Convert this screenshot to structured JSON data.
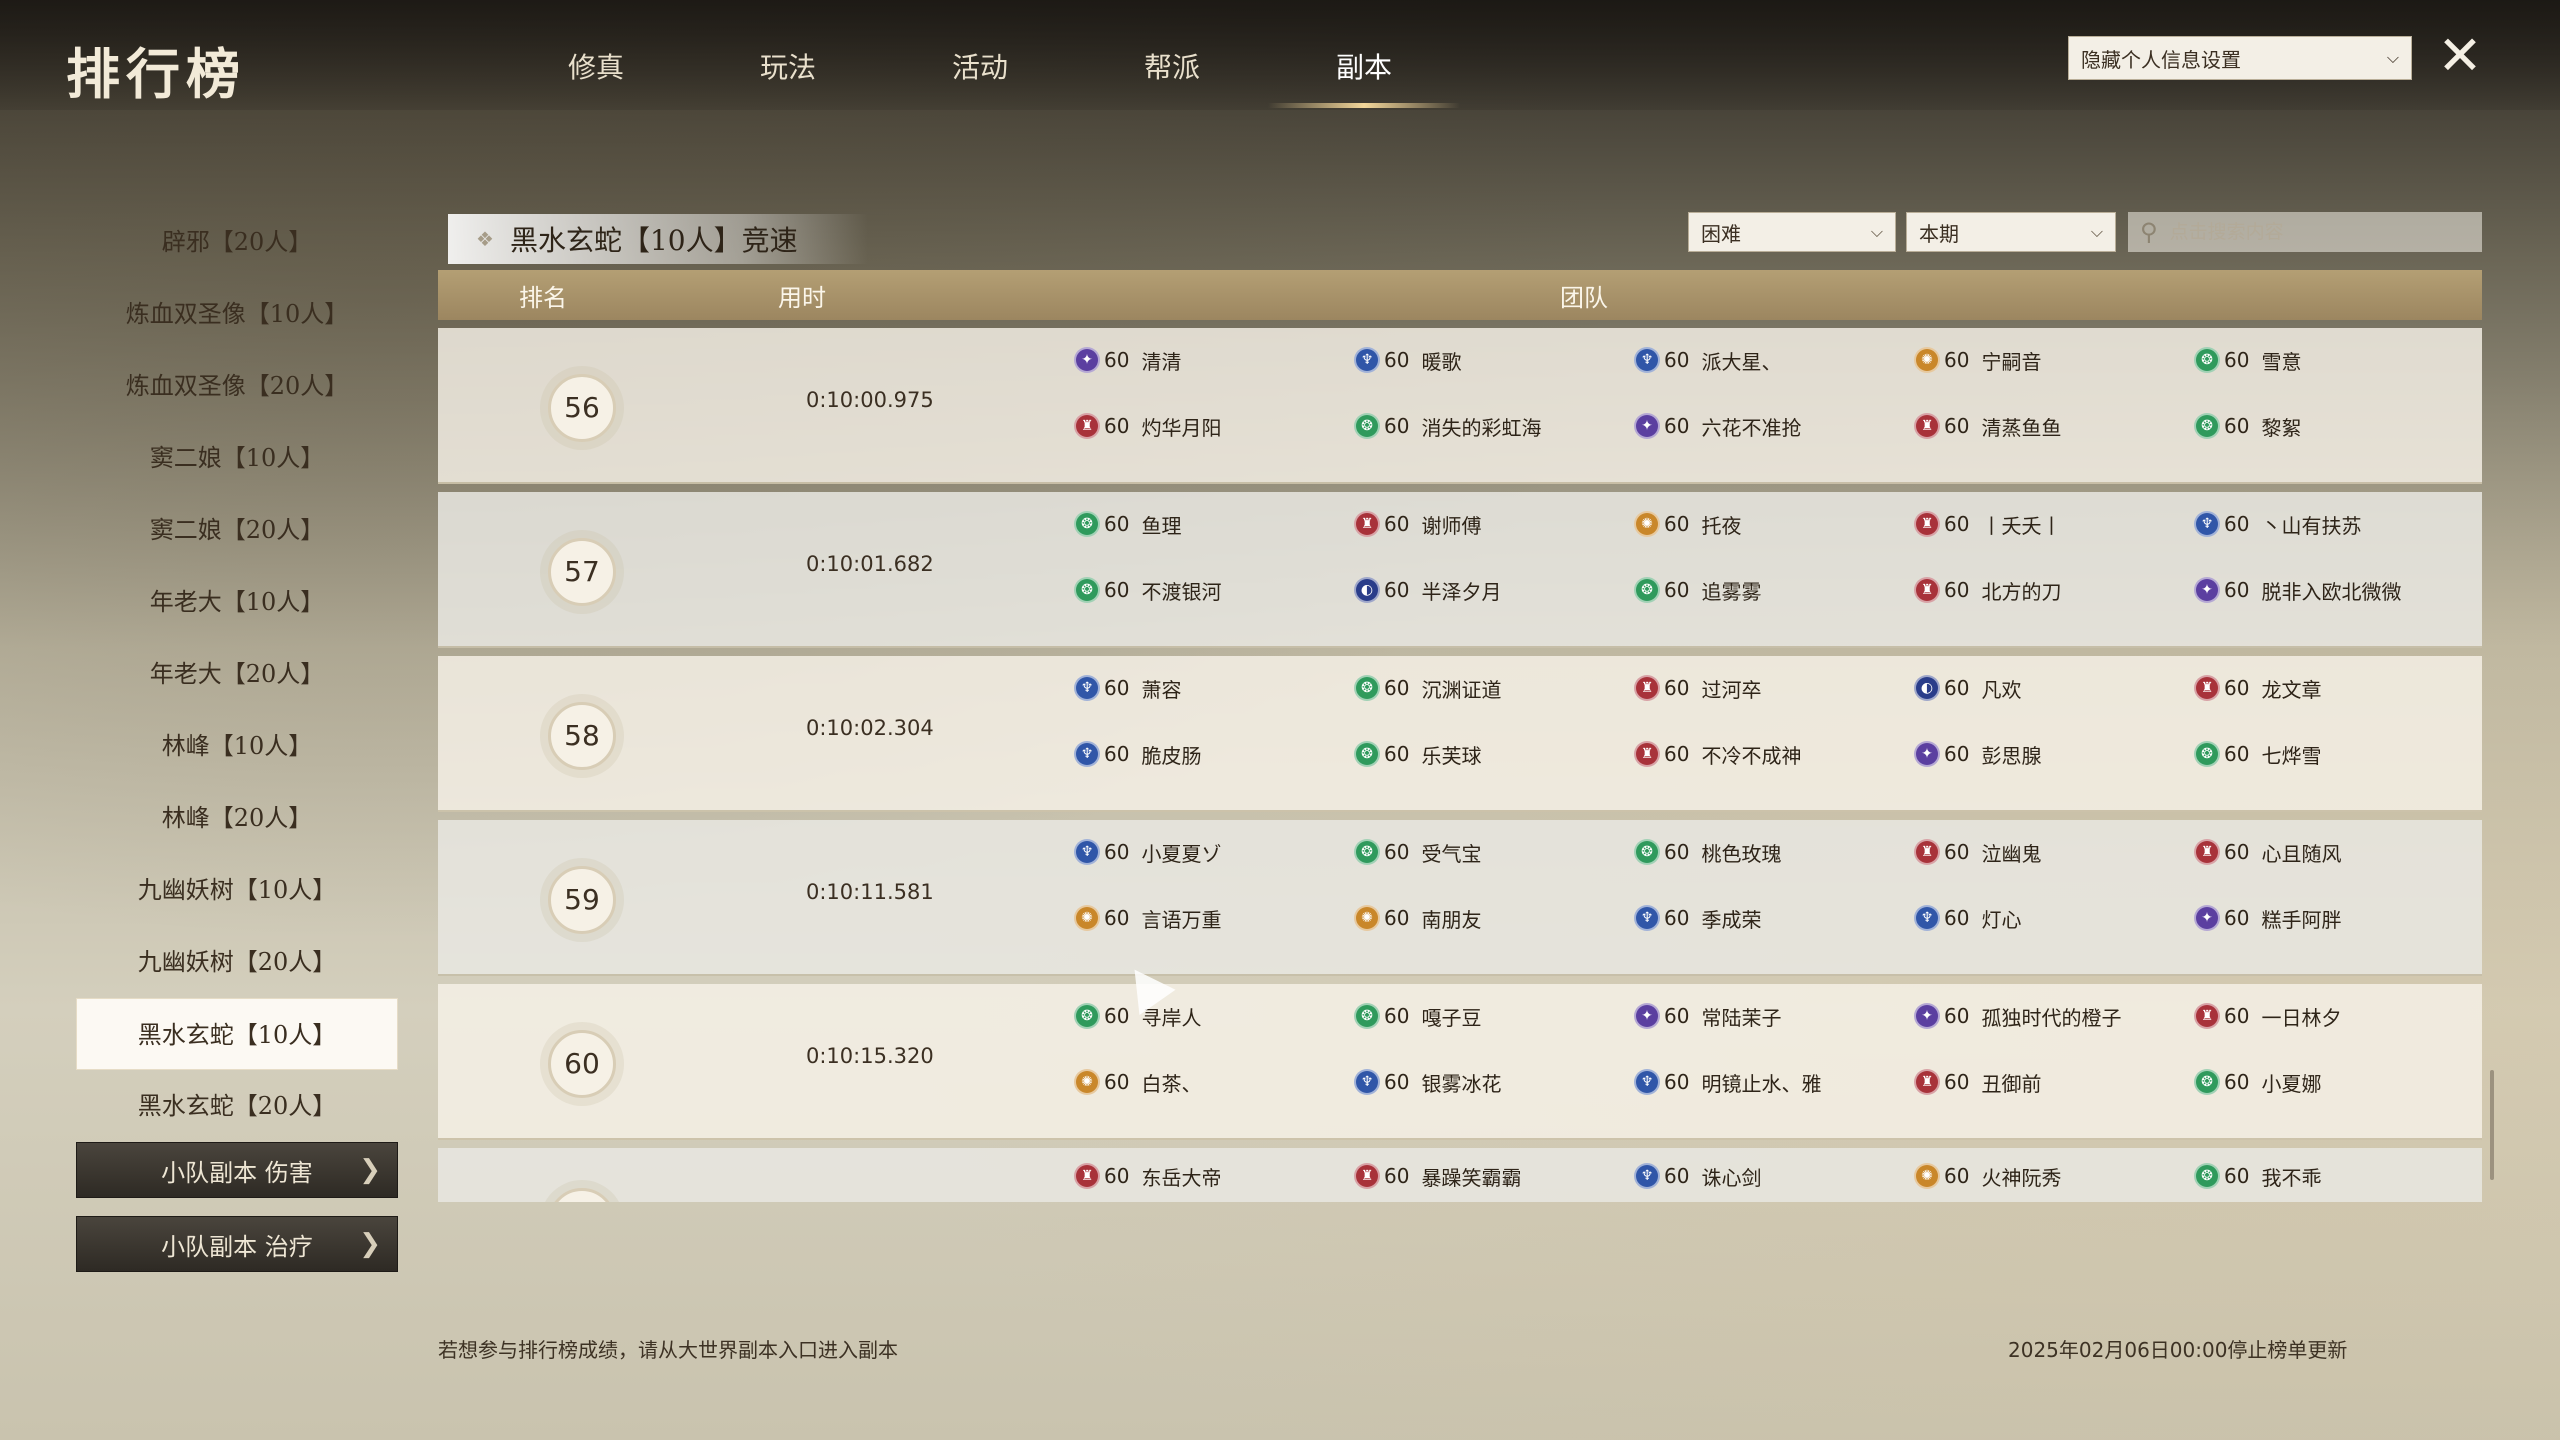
{
  "header": {
    "title": "排行榜",
    "tabs": [
      {
        "label": "修真",
        "active": false
      },
      {
        "label": "玩法",
        "active": false
      },
      {
        "label": "活动",
        "active": false
      },
      {
        "label": "帮派",
        "active": false
      },
      {
        "label": "副本",
        "active": true
      }
    ],
    "privacy_select": "隐藏个人信息设置",
    "close_icon": "close-icon"
  },
  "sidebar": {
    "items": [
      {
        "label": "辟邪【20人】",
        "active": false
      },
      {
        "label": "炼血双圣像【10人】",
        "active": false
      },
      {
        "label": "炼血双圣像【20人】",
        "active": false
      },
      {
        "label": "窦二娘【10人】",
        "active": false
      },
      {
        "label": "窦二娘【20人】",
        "active": false
      },
      {
        "label": "年老大【10人】",
        "active": false
      },
      {
        "label": "年老大【20人】",
        "active": false
      },
      {
        "label": "林峰【10人】",
        "active": false
      },
      {
        "label": "林峰【20人】",
        "active": false
      },
      {
        "label": "九幽妖树【10人】",
        "active": false
      },
      {
        "label": "九幽妖树【20人】",
        "active": false
      },
      {
        "label": "黑水玄蛇【10人】",
        "active": true
      },
      {
        "label": "黑水玄蛇【20人】",
        "active": false
      }
    ],
    "squad_buttons": [
      {
        "label": "小队副本 伤害"
      },
      {
        "label": "小队副本 治疗"
      }
    ]
  },
  "panel": {
    "dungeon_title": "黑水玄蛇【10人】竞速",
    "difficulty": "困难",
    "period": "本期",
    "search_placeholder": "点击搜索内容"
  },
  "table": {
    "headers": {
      "rank": "排名",
      "time": "用时",
      "team": "团队"
    },
    "school_colors": {
      "purple": "#5b3fa0",
      "blue": "#3056a8",
      "green": "#2f9a5c",
      "red": "#a8323a",
      "gold": "#c9872a",
      "navy": "#2a3d8a"
    },
    "rows": [
      {
        "rank": "56",
        "time": "0:10:00.975",
        "members": [
          {
            "school": "purple",
            "level": "60",
            "name": "清清"
          },
          {
            "school": "blue",
            "level": "60",
            "name": "暖歌"
          },
          {
            "school": "blue",
            "level": "60",
            "name": "派大星、"
          },
          {
            "school": "gold",
            "level": "60",
            "name": "宁嗣音"
          },
          {
            "school": "green",
            "level": "60",
            "name": "雪意"
          },
          {
            "school": "red",
            "level": "60",
            "name": "灼华月阳"
          },
          {
            "school": "green",
            "level": "60",
            "name": "消失的彩虹海"
          },
          {
            "school": "purple",
            "level": "60",
            "name": "六花不准抢"
          },
          {
            "school": "red",
            "level": "60",
            "name": "清蒸鱼鱼"
          },
          {
            "school": "green",
            "level": "60",
            "name": "黎絮"
          }
        ]
      },
      {
        "rank": "57",
        "time": "0:10:01.682",
        "members": [
          {
            "school": "green",
            "level": "60",
            "name": "鱼理"
          },
          {
            "school": "red",
            "level": "60",
            "name": "谢师傅"
          },
          {
            "school": "gold",
            "level": "60",
            "name": "托夜"
          },
          {
            "school": "red",
            "level": "60",
            "name": "丨夭夭丨"
          },
          {
            "school": "blue",
            "level": "60",
            "name": "丶山有扶苏"
          },
          {
            "school": "green",
            "level": "60",
            "name": "不渡银河"
          },
          {
            "school": "navy",
            "level": "60",
            "name": "半泽夕月"
          },
          {
            "school": "green",
            "level": "60",
            "name": "追雾雾"
          },
          {
            "school": "red",
            "level": "60",
            "name": "北方的刀"
          },
          {
            "school": "purple",
            "level": "60",
            "name": "脱非入欧北微微"
          }
        ]
      },
      {
        "rank": "58",
        "time": "0:10:02.304",
        "members": [
          {
            "school": "blue",
            "level": "60",
            "name": "萧容"
          },
          {
            "school": "green",
            "level": "60",
            "name": "沉渊证道"
          },
          {
            "school": "red",
            "level": "60",
            "name": "过河卒"
          },
          {
            "school": "navy",
            "level": "60",
            "name": "凡欢"
          },
          {
            "school": "red",
            "level": "60",
            "name": "龙文章"
          },
          {
            "school": "blue",
            "level": "60",
            "name": "脆皮肠"
          },
          {
            "school": "green",
            "level": "60",
            "name": "乐芙球"
          },
          {
            "school": "red",
            "level": "60",
            "name": "不冷不成神"
          },
          {
            "school": "purple",
            "level": "60",
            "name": "彭思腺"
          },
          {
            "school": "green",
            "level": "60",
            "name": "七烨雪"
          }
        ]
      },
      {
        "rank": "59",
        "time": "0:10:11.581",
        "members": [
          {
            "school": "blue",
            "level": "60",
            "name": "小夏夏ゾ"
          },
          {
            "school": "green",
            "level": "60",
            "name": "受气宝"
          },
          {
            "school": "green",
            "level": "60",
            "name": "桃色玫瑰"
          },
          {
            "school": "red",
            "level": "60",
            "name": "泣幽鬼"
          },
          {
            "school": "red",
            "level": "60",
            "name": "心且随风"
          },
          {
            "school": "gold",
            "level": "60",
            "name": "言语万重"
          },
          {
            "school": "gold",
            "level": "60",
            "name": "南朋友"
          },
          {
            "school": "blue",
            "level": "60",
            "name": "季成荣"
          },
          {
            "school": "blue",
            "level": "60",
            "name": "灯心"
          },
          {
            "school": "purple",
            "level": "60",
            "name": "糕手阿胖"
          }
        ]
      },
      {
        "rank": "60",
        "time": "0:10:15.320",
        "members": [
          {
            "school": "green",
            "level": "60",
            "name": "寻岸人"
          },
          {
            "school": "green",
            "level": "60",
            "name": "嘎子豆"
          },
          {
            "school": "purple",
            "level": "60",
            "name": "常陆茉子"
          },
          {
            "school": "purple",
            "level": "60",
            "name": "孤独时代的橙子"
          },
          {
            "school": "red",
            "level": "60",
            "name": "一日林夕"
          },
          {
            "school": "gold",
            "level": "60",
            "name": "白茶、"
          },
          {
            "school": "blue",
            "level": "60",
            "name": "银雾冰花"
          },
          {
            "school": "blue",
            "level": "60",
            "name": "明镜止水、雅"
          },
          {
            "school": "red",
            "level": "60",
            "name": "丑御前"
          },
          {
            "school": "green",
            "level": "60",
            "name": "小夏娜"
          }
        ]
      },
      {
        "rank": "",
        "time": "",
        "members": [
          {
            "school": "red",
            "level": "60",
            "name": "东岳大帝"
          },
          {
            "school": "red",
            "level": "60",
            "name": "暴躁笑霸霸"
          },
          {
            "school": "blue",
            "level": "60",
            "name": "诛心剑"
          },
          {
            "school": "gold",
            "level": "60",
            "name": "火神阮秀"
          },
          {
            "school": "green",
            "level": "60",
            "name": "我不乖"
          }
        ]
      }
    ]
  },
  "footer": {
    "note": "若想参与排行榜成绩，请从大世界副本入口进入副本",
    "update_date": "2025年02月06日00:00停止榜单更新"
  }
}
